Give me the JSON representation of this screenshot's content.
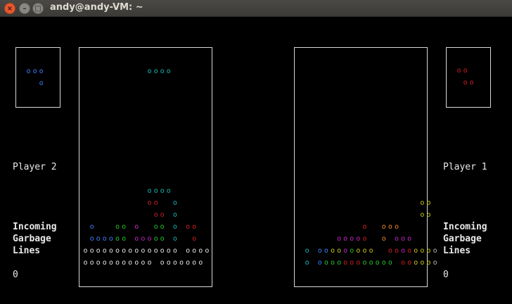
{
  "window": {
    "title": "andy@andy-VM: ~",
    "buttons": {
      "close": "×",
      "minimize": "–",
      "maximize": "□"
    }
  },
  "colors": {
    "white": "#e6e6e6",
    "cyan": "#16b6b6",
    "blue": "#3e7fff",
    "red": "#d21f1f",
    "green": "#24c62a",
    "magenta": "#c626c6",
    "yellow": "#c8c81a",
    "orange": "#ec8a2a",
    "grey": "#b8b8b8"
  },
  "glyph": "o",
  "legend": {
    "W": "white",
    "C": "cyan",
    "B": "blue",
    "R": "red",
    "G": "green",
    "M": "magenta",
    "Y": "yellow",
    "O": "orange",
    "g": "grey"
  },
  "player2": {
    "name": "Player 2",
    "garbage_title": [
      "Incoming",
      "Garbage",
      "Lines"
    ],
    "garbage_count": "0",
    "next_piece": [
      "BBB",
      "..B"
    ],
    "board": [
      "..........CCCC....",
      "..................",
      "..................",
      "..................",
      "..................",
      "..................",
      "..................",
      "..................",
      "..................",
      "..................",
      "..........CCCC....",
      "..........RR..C...",
      "...........RR.C...",
      ".B...GG.M..GG.C.RR",
      ".BBBBGG.MMMGG.C..R",
      "WWWWWWWWWWWWWWW.WWWW",
      "WWWWWWWWWWW.WWWWWWW"
    ]
  },
  "player1": {
    "name": "Player 1",
    "garbage_title": [
      "Incoming",
      "Garbage",
      "Lines"
    ],
    "garbage_count": "0",
    "next_piece": [
      "RR",
      ".RR"
    ],
    "board": [
      "..................",
      "..................",
      "..................",
      "..................",
      "..................",
      "..................",
      "..................",
      "..................",
      "..................",
      "..................",
      "..................",
      "...................YY",
      "...................YY",
      "..........R..OOO....",
      "......MMMMR..O.MMM..",
      ".C.BBYYMGYYY..RRMRYYYg",
      ".C.BGGGRRRGGGGG.RRYYYg"
    ]
  }
}
